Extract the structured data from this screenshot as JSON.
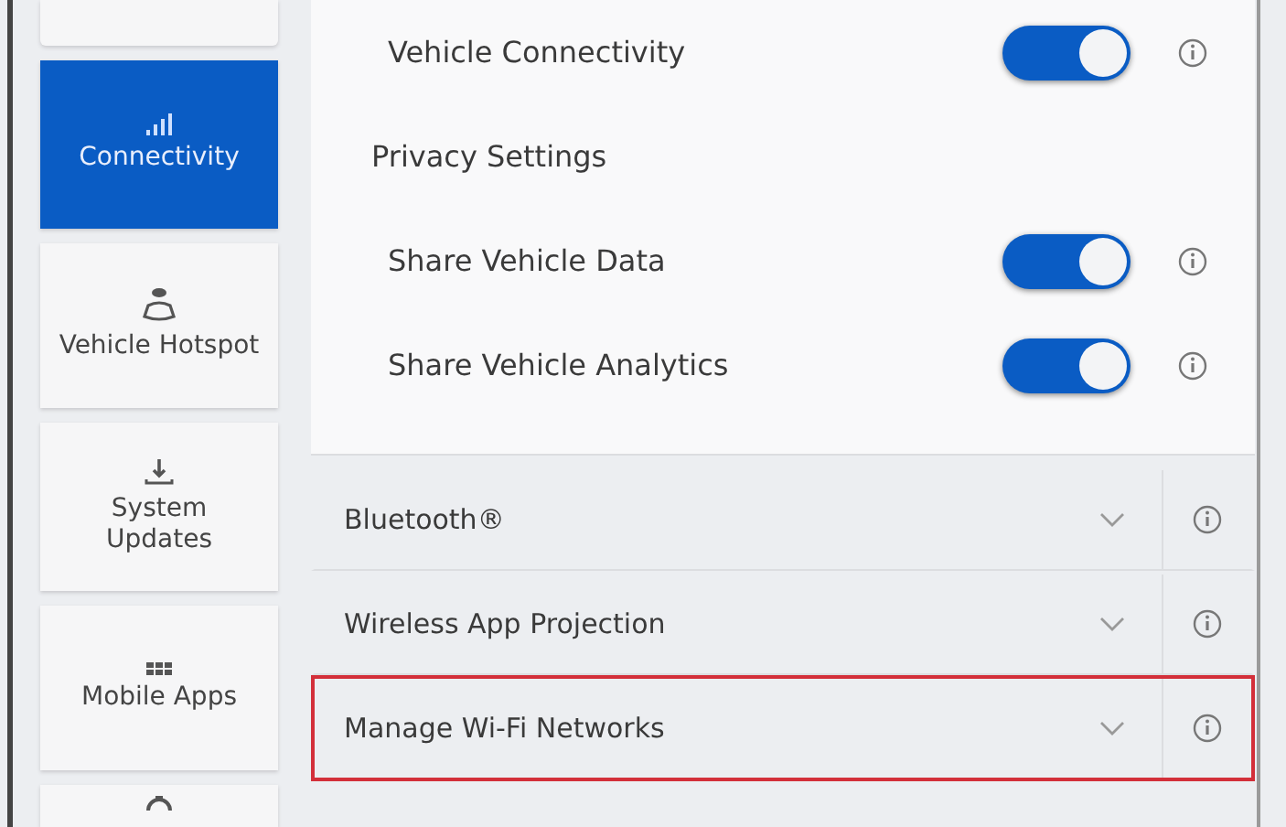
{
  "sidebar": {
    "items": [
      {
        "kind": "partial-top",
        "selected": false
      },
      {
        "label": "Connectivity",
        "kind": "signal",
        "selected": true
      },
      {
        "label": "Vehicle Hotspot",
        "kind": "hotspot",
        "selected": false
      },
      {
        "label": "System Updates",
        "kind": "download",
        "selected": false
      },
      {
        "label": "Mobile Apps",
        "kind": "apps",
        "selected": false
      },
      {
        "kind": "partial-gear",
        "selected": false
      }
    ]
  },
  "expanded_section": {
    "rows": [
      {
        "kind": "toggle",
        "label": "Vehicle Connectivity",
        "on": true
      },
      {
        "kind": "header",
        "label": "Privacy Settings"
      },
      {
        "kind": "toggle",
        "label": "Share Vehicle Data",
        "on": true
      },
      {
        "kind": "toggle",
        "label": "Share Vehicle Analytics",
        "on": true
      }
    ]
  },
  "sections": [
    {
      "label": "Bluetooth®",
      "expanded": false,
      "highlighted": false
    },
    {
      "label": "Wireless App Projection",
      "expanded": false,
      "highlighted": false
    },
    {
      "label": "Manage Wi-Fi Networks",
      "expanded": false,
      "highlighted": true
    }
  ]
}
